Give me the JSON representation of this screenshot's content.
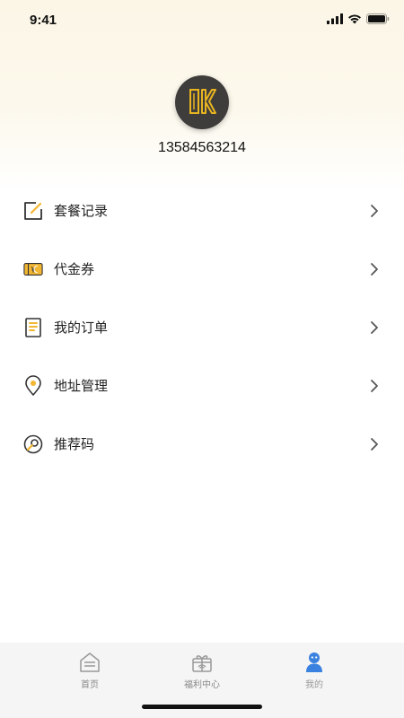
{
  "status_bar": {
    "time": "9:41"
  },
  "profile": {
    "avatar_monogram": "UK",
    "phone": "13584563214"
  },
  "menu": [
    {
      "label": "套餐记录",
      "icon": "edit-note-icon"
    },
    {
      "label": "代金券",
      "icon": "voucher-icon"
    },
    {
      "label": "我的订单",
      "icon": "order-list-icon"
    },
    {
      "label": "地址管理",
      "icon": "location-pin-icon"
    },
    {
      "label": "推荐码",
      "icon": "referral-code-icon"
    }
  ],
  "tabbar": {
    "tabs": [
      {
        "label": "首页",
        "icon": "home-icon",
        "active": false
      },
      {
        "label": "福利中心",
        "icon": "gift-icon",
        "active": false
      },
      {
        "label": "我的",
        "icon": "user-icon",
        "active": true
      }
    ]
  },
  "colors": {
    "accent_yellow": "#f2b632",
    "active_blue": "#3b82e0",
    "avatar_bg": "#3f3d3c"
  }
}
